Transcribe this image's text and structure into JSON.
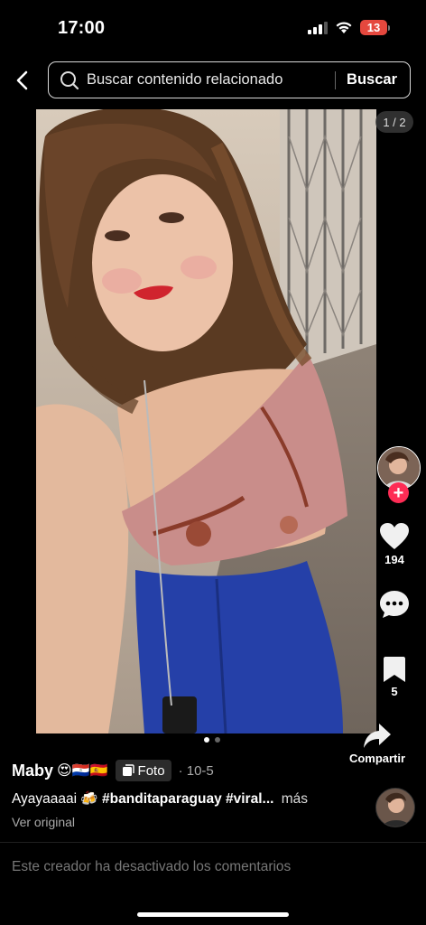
{
  "status": {
    "time": "17:00",
    "battery": "13"
  },
  "search": {
    "placeholder": "Buscar contenido relacionado",
    "button": "Buscar"
  },
  "post": {
    "page_indicator": "1 / 2",
    "author": "Maby",
    "author_emojis": "😍🇵🇾🇪🇸",
    "type_label": "Foto",
    "date": "· 10-5",
    "caption_text": "Ayayaaaai",
    "caption_emoji": "🍻",
    "hashtags": "#banditaparaguay #viral...",
    "more_label": "más",
    "see_original": "Ver original",
    "comments_disabled": "Este creador ha desactivado los comentarios"
  },
  "rail": {
    "likes": "194",
    "bookmarks": "5",
    "share_label": "Compartir"
  },
  "colors": {
    "follow": "#fe2c55",
    "battery": "#e5483e"
  },
  "icons": [
    "back-icon",
    "search-icon",
    "heart-icon",
    "comment-icon",
    "bookmark-icon",
    "share-icon",
    "plus-icon",
    "photo-icon"
  ]
}
